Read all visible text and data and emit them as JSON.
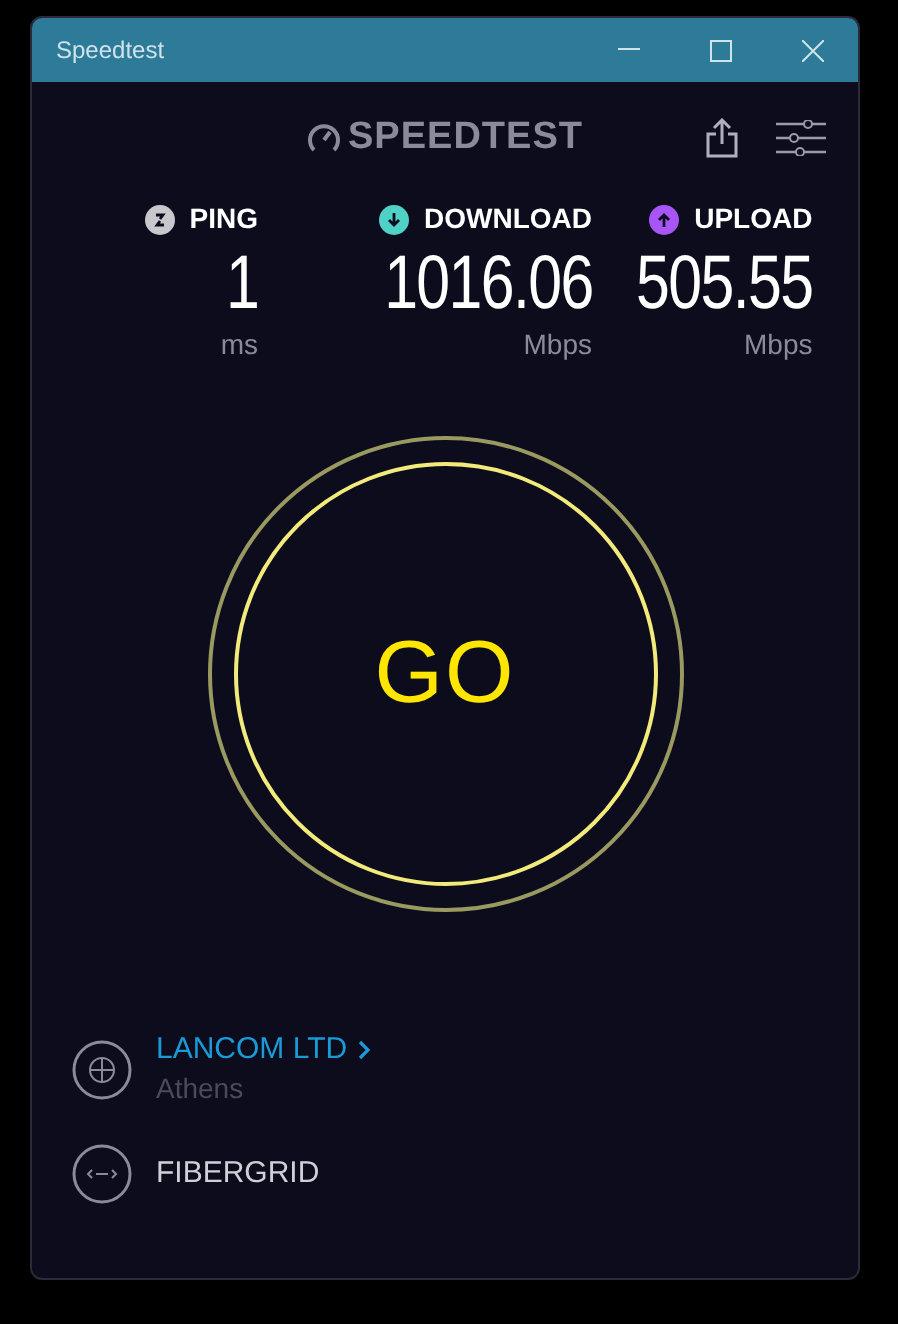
{
  "window": {
    "title": "Speedtest"
  },
  "logo": {
    "text": "SPEEDTEST"
  },
  "metrics": [
    {
      "kind": "ping",
      "label": "PING",
      "value": "1",
      "unit": "ms",
      "color": "#c8c8cc"
    },
    {
      "kind": "download",
      "label": "DOWNLOAD",
      "value": "1016.06",
      "unit": "Mbps",
      "color": "#4fd1c5"
    },
    {
      "kind": "upload",
      "label": "UPLOAD",
      "value": "505.55",
      "unit": "Mbps",
      "color": "#a855f7"
    }
  ],
  "go_button": {
    "label": "GO"
  },
  "server": {
    "name": "LANCOM LTD",
    "location": "Athens"
  },
  "provider": {
    "name": "FIBERGRID"
  }
}
